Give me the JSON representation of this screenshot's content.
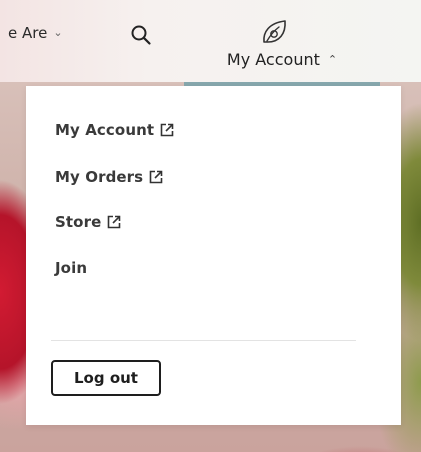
{
  "nav": {
    "who_label": "e Are",
    "who_icon": "chevron-down-icon",
    "search_icon": "search-icon",
    "account_icon": "leaf-icon",
    "account_label": "My Account",
    "account_chevron": "chevron-up-icon",
    "active_underline_color": "#86a7ad"
  },
  "dropdown": {
    "items": [
      {
        "label": "My Account",
        "external": true
      },
      {
        "label": "My Orders",
        "external": true
      },
      {
        "label": "Store",
        "external": true
      },
      {
        "label": "Join",
        "external": false
      }
    ],
    "logout_label": "Log out"
  }
}
